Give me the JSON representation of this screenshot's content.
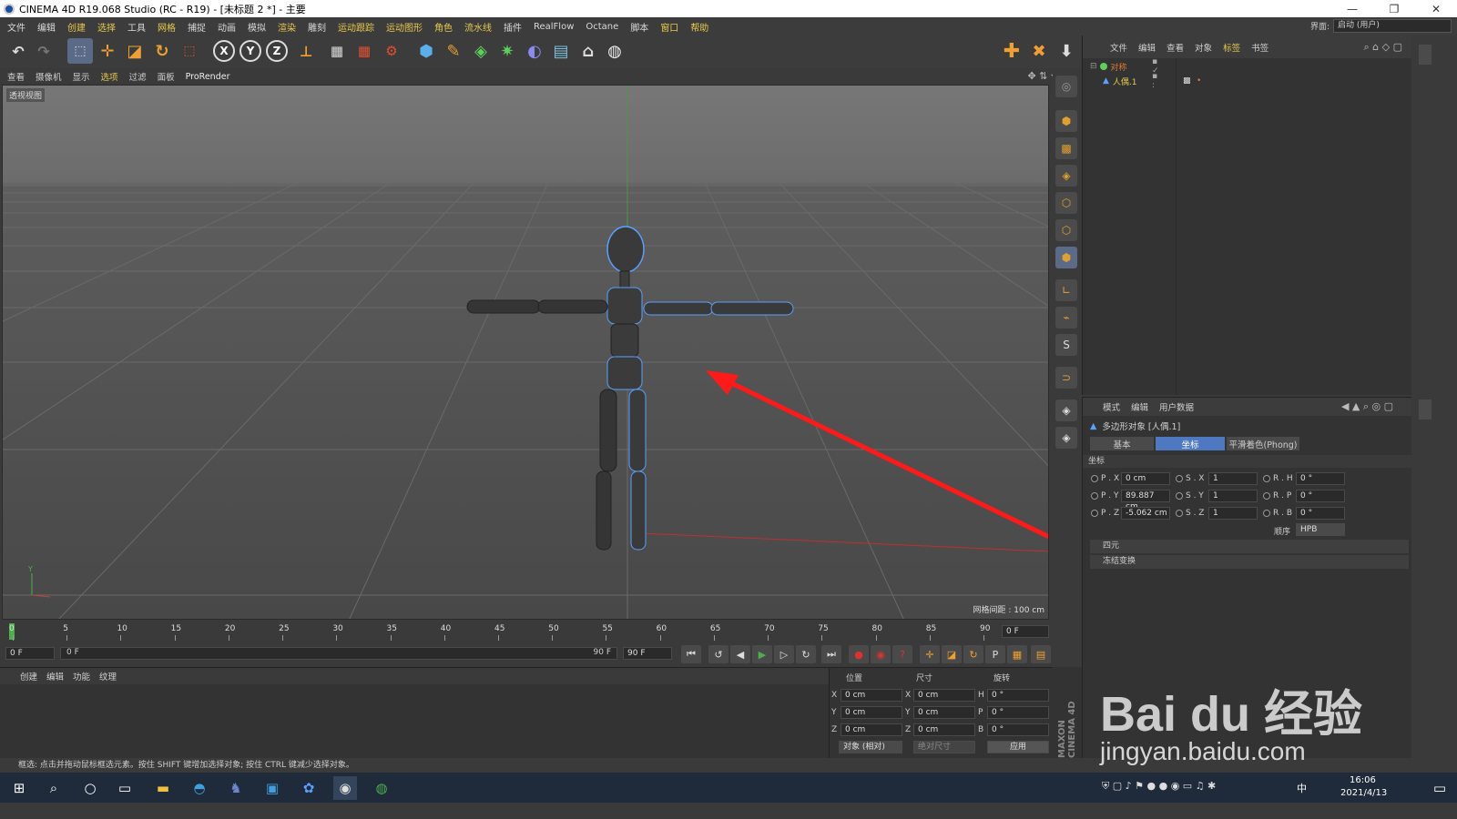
{
  "window": {
    "title": "CINEMA 4D R19.068 Studio (RC - R19) - [未标题 2 *] - 主要",
    "min": "—",
    "max": "❐",
    "close": "✕"
  },
  "menu": {
    "items": [
      "文件",
      "编辑",
      "创建",
      "选择",
      "工具",
      "网格",
      "捕捉",
      "动画",
      "模拟",
      "渲染",
      "雕刻",
      "运动跟踪",
      "运动图形",
      "角色",
      "流水线",
      "插件",
      "RealFlow",
      "Octane",
      "脚本",
      "窗口",
      "帮助"
    ],
    "layout_label": "界面:",
    "layout_value": "启动 (用户)"
  },
  "viewport_menu": {
    "items": [
      "查看",
      "摄像机",
      "显示",
      "选项",
      "过滤",
      "面板",
      "ProRender"
    ],
    "view_label": "透视视图",
    "grid_label": "网格间距 : 100 cm"
  },
  "object_manager": {
    "tabs": [
      "文件",
      "编辑",
      "查看",
      "对象",
      "标签",
      "书签"
    ],
    "tree": [
      {
        "name": "对称"
      },
      {
        "name": "人偶.1"
      }
    ]
  },
  "attributes": {
    "tabs_head": [
      "模式",
      "编辑",
      "用户数据"
    ],
    "object_title": "多边形对象 [人偶.1]",
    "tabs": [
      "基本",
      "坐标",
      "平滑着色(Phong)"
    ],
    "active_tab": "坐标",
    "section_title": "坐标",
    "rows": [
      {
        "p_label": "P . X",
        "p_val": "0 cm",
        "s_label": "S . X",
        "s_val": "1",
        "r_label": "R . H",
        "r_val": "0 °"
      },
      {
        "p_label": "P . Y",
        "p_val": "89.887 cm",
        "s_label": "S . Y",
        "s_val": "1",
        "r_label": "R . P",
        "r_val": "0 °"
      },
      {
        "p_label": "P . Z",
        "p_val": "-5.062 cm",
        "s_label": "S . Z",
        "s_val": "1",
        "r_label": "R . B",
        "r_val": "0 °"
      }
    ],
    "order_label": "顺序",
    "order_value": "HPB",
    "sections": [
      "四元",
      "冻结变换"
    ]
  },
  "timeline": {
    "ticks": [
      "0",
      "5",
      "10",
      "15",
      "20",
      "25",
      "30",
      "35",
      "40",
      "45",
      "50",
      "55",
      "60",
      "65",
      "70",
      "75",
      "80",
      "85",
      "90"
    ],
    "current_frame": "0 F",
    "start": "0 F",
    "range_start": "0 F",
    "range_end": "90 F",
    "end": "90 F"
  },
  "material": {
    "tabs": [
      "创建",
      "编辑",
      "功能",
      "纹理"
    ]
  },
  "coords": {
    "headers": [
      "位置",
      "尺寸",
      "旋转"
    ],
    "rows": [
      {
        "a": "X",
        "pos": "0 cm",
        "b": "X",
        "size": "0 cm",
        "c": "H",
        "rot": "0 °"
      },
      {
        "a": "Y",
        "pos": "0 cm",
        "b": "Y",
        "size": "0 cm",
        "c": "P",
        "rot": "0 °"
      },
      {
        "a": "Z",
        "pos": "0 cm",
        "b": "Z",
        "size": "0 cm",
        "c": "B",
        "rot": "0 °"
      }
    ],
    "mode1": "对象 (相对)",
    "mode2": "绝对尺寸",
    "apply": "应用"
  },
  "brand": "MAXON CINEMA 4D",
  "status": "框选: 点击并拖动鼠标框选元素。按住 SHIFT 键增加选择对象; 按住 CTRL 键减少选择对象。",
  "taskbar": {
    "time": "16:06",
    "date": "2021/4/13",
    "ime": "中"
  },
  "watermark": {
    "text": "Bai du 经验",
    "url": "jingyan.baidu.com"
  },
  "colors": {
    "accent": "#4e79c0",
    "selection_blue": "#5aa0ff",
    "arrow_red": "#ff1a1a"
  }
}
